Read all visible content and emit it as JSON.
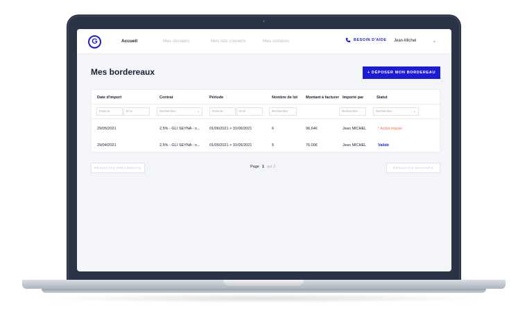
{
  "brand": {
    "logo_letter": "G",
    "accent": "#1c1cd6"
  },
  "nav": {
    "items": [
      {
        "label": "Accueil",
        "active": true
      },
      {
        "label": "Mes dossiers",
        "active": false
      },
      {
        "label": "Mes lots couverts",
        "active": false
      },
      {
        "label": "Mes sinistres",
        "active": false
      }
    ],
    "help_label": "BESOIN D'AIDE",
    "user_name": "Jean-Michel"
  },
  "page": {
    "title": "Mes bordereaux",
    "deposit_button": "+ DÉPOSER MON BORDEREAU"
  },
  "table": {
    "columns": [
      "Date d'import",
      "Contrat",
      "Période",
      "Nombre de lot",
      "Montant à facturer",
      "Importé par",
      "Statut"
    ],
    "filters": {
      "date_from": "Entre le",
      "date_to": "Et le",
      "contract": "Rechercher",
      "period_from": "Entre le",
      "period_to": "Et le",
      "lots": "Rechercher",
      "imported_by": "Rechercher",
      "status": "Rechercher"
    },
    "rows": [
      {
        "date": "29/05/2021",
        "contract": "2,5% - GLI SEYNA - n...",
        "period": "01/06/2021 > 31/06/2021",
        "lots": "6",
        "amount": "96,64€",
        "imported_by": "Jean MICHEL",
        "status": "Action requise",
        "status_kind": "pending"
      },
      {
        "date": "29/04/2021",
        "contract": "2,5% - GLI SEYNA - n...",
        "period": "01/05/2021 > 31/05/2021",
        "lots": "5",
        "amount": "76.00€",
        "imported_by": "Jean MICHEL",
        "status": "Validé",
        "status_kind": "validated"
      }
    ]
  },
  "pagination": {
    "prev_label": "RÉSULTATS PRÉCÉDENTS",
    "next_label": "RÉSULTATS SUIVANTS",
    "page_label": "Page",
    "current": "1",
    "of_label": "sur 2"
  }
}
